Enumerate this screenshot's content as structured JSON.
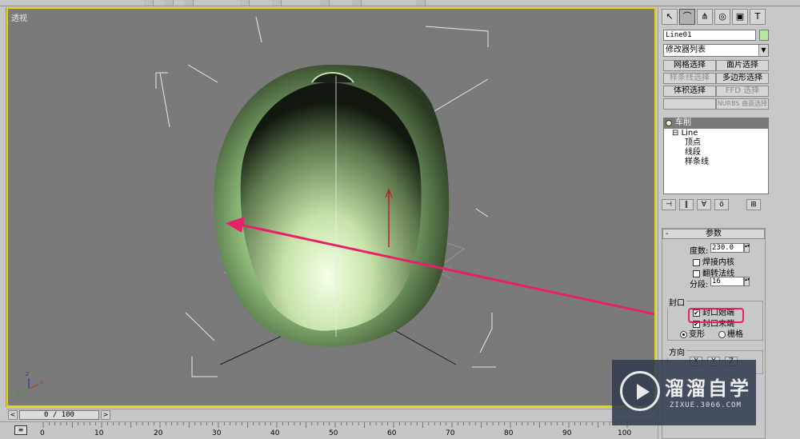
{
  "viewport": {
    "label": "透视",
    "axis_x": "x",
    "axis_y": "y",
    "axis_z": "z"
  },
  "time_slider": {
    "prev": "<",
    "frame": "0 / 100",
    "next": ">"
  },
  "track_ruler": {
    "ticks": [
      "0",
      "10",
      "20",
      "30",
      "40",
      "50",
      "60",
      "70",
      "80",
      "90",
      "100"
    ]
  },
  "command_panel": {
    "object_name": "Line01",
    "object_color": "#b8e6a0",
    "modifier_list": "修改器列表",
    "selection_buttons": [
      {
        "label": "网格选择",
        "enabled": true
      },
      {
        "label": "面片选择",
        "enabled": true
      },
      {
        "label": "样条线选择",
        "enabled": false
      },
      {
        "label": "多边形选择",
        "enabled": true
      },
      {
        "label": "体积选择",
        "enabled": true
      },
      {
        "label": "FFD 选择",
        "enabled": false
      },
      {
        "label": "",
        "enabled": false
      },
      {
        "label": "NURBS 曲面选择",
        "enabled": false
      }
    ],
    "stack": {
      "top_modifier": "车削",
      "base_object": "Line",
      "sub_objects": [
        "顶点",
        "线段",
        "样条线"
      ]
    },
    "params": {
      "title": "参数",
      "degrees_label": "度数:",
      "degrees_value": "230.0",
      "weld_core": "焊接内核",
      "flip_normals": "翻转法线",
      "segments_label": "分段:",
      "segments_value": "16",
      "capping_title": "封口",
      "cap_start": "封口始端",
      "cap_start_checked": true,
      "cap_end": "封口末端",
      "cap_end_checked": true,
      "morph": "变形",
      "grid": "栅格",
      "direction_title": "方向",
      "dir_x": "X",
      "dir_y": "Y",
      "dir_z": "Z"
    }
  },
  "watermark": {
    "title": "溜溜自学",
    "subtitle": "ZIXUE.3066.COM"
  },
  "colors": {
    "viewport_bg": "#7a7a7a",
    "active_border": "#e6d400",
    "object_green": "#8fbf7a",
    "annotation": "#e8206a"
  }
}
